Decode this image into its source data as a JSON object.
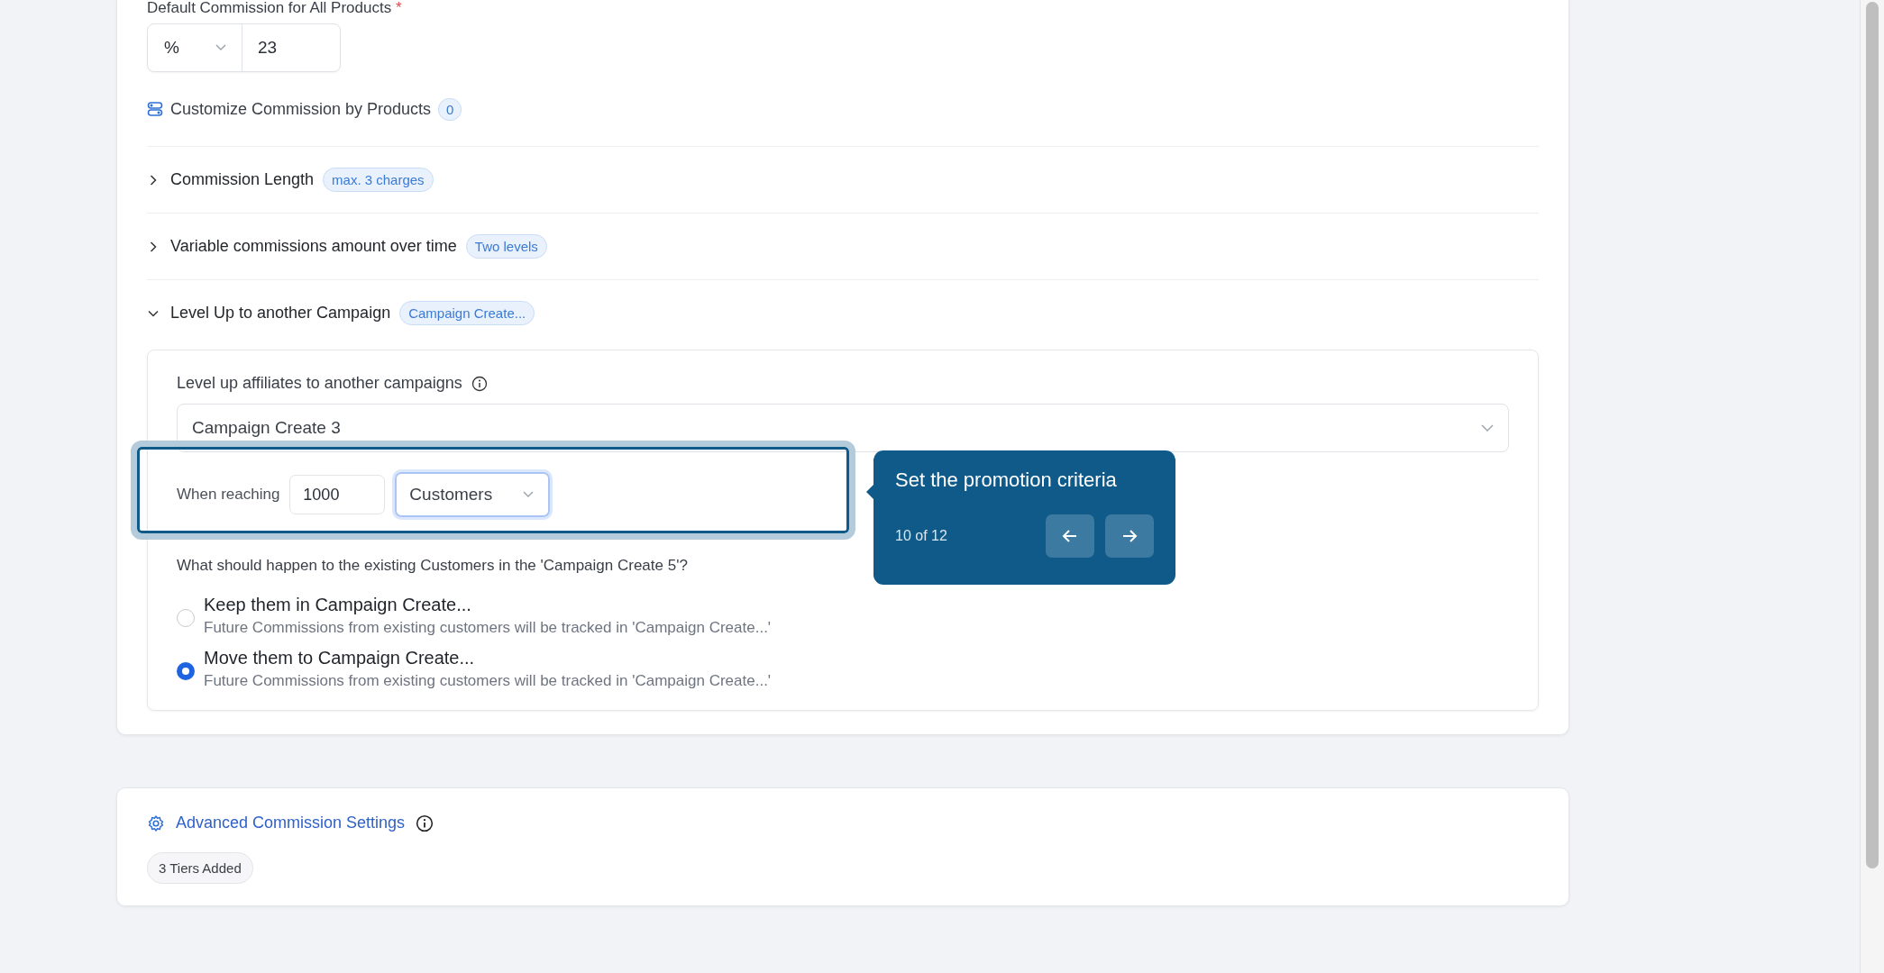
{
  "default_commission": {
    "label": "Default Commission for All Products",
    "required_mark": "*",
    "unit": "%",
    "value": "23"
  },
  "customize_products": {
    "label": "Customize Commission by Products",
    "count": "0"
  },
  "sections": [
    {
      "title": "Commission Length",
      "badge": "max. 3 charges",
      "expanded": false
    },
    {
      "title": "Variable commissions amount over time",
      "badge": "Two levels",
      "expanded": false
    },
    {
      "title": "Level Up to another Campaign",
      "badge": "Campaign Create...",
      "expanded": true
    }
  ],
  "level_up": {
    "label": "Level up affiliates to another campaigns",
    "campaign": "Campaign Create 3",
    "reaching_label": "When reaching",
    "reaching_value": "1000",
    "reaching_unit": "Customers",
    "question": "What should happen to the existing Customers in the 'Campaign Create 5'?",
    "options": [
      {
        "title": "Keep them in Campaign Create...",
        "description": "Future Commissions from existing customers will be tracked in 'Campaign Create...'",
        "selected": false
      },
      {
        "title": "Move them to Campaign Create...",
        "description": "Future Commissions from existing customers will be tracked in 'Campaign Create...'",
        "selected": true
      }
    ]
  },
  "tour": {
    "title": "Set the promotion criteria",
    "step": "10 of 12"
  },
  "advanced": {
    "title": "Advanced Commission Settings",
    "chip": "3 Tiers Added"
  }
}
